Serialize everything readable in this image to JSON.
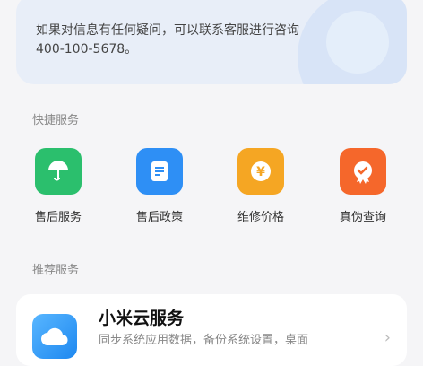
{
  "info": {
    "line1": "如果对信息有任何疑问，可以联系客服进行咨询",
    "line2": "400-100-5678。"
  },
  "quick": {
    "title": "快捷服务",
    "items": [
      {
        "label": "售后服务",
        "icon": "umbrella-icon",
        "color": "#2bbf6d"
      },
      {
        "label": "售后政策",
        "icon": "document-icon",
        "color": "#2e8ff5"
      },
      {
        "label": "维修价格",
        "icon": "yen-icon",
        "color": "#f5a623"
      },
      {
        "label": "真伪查询",
        "icon": "badge-check-icon",
        "color": "#f5672b"
      }
    ]
  },
  "recommend": {
    "title": "推荐服务",
    "card": {
      "name": "小米云服务",
      "desc": "同步系统应用数据，备份系统设置，桌面",
      "icon": "cloud-icon"
    }
  }
}
